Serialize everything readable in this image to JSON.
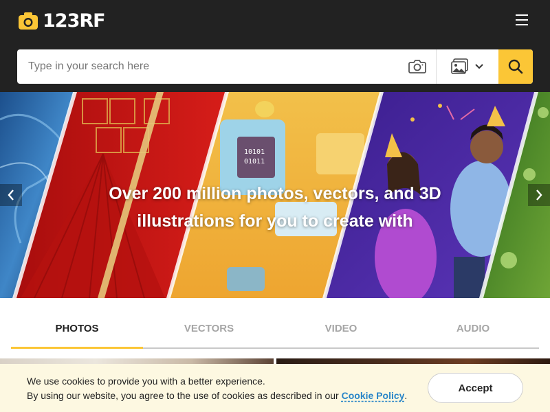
{
  "brand": {
    "logo_text": "123RF",
    "accent_color": "#fbc636",
    "header_bg": "#222222"
  },
  "header": {
    "menu_icon": "hamburger-menu-icon"
  },
  "search": {
    "placeholder": "Type in your search here",
    "value": "",
    "camera_icon": "camera-icon",
    "type_icon": "image-icon",
    "dropdown_icon": "chevron-down-icon",
    "submit_icon": "search-icon"
  },
  "hero": {
    "title_line1": "Over 200 million photos, vectors, and 3D",
    "title_line2": "illustrations for you to create with",
    "prev_icon": "chevron-left-icon",
    "next_icon": "chevron-right-icon"
  },
  "tabs": [
    {
      "label": "PHOTOS",
      "active": true
    },
    {
      "label": "VECTORS",
      "active": false
    },
    {
      "label": "VIDEO",
      "active": false
    },
    {
      "label": "AUDIO",
      "active": false
    }
  ],
  "cookie": {
    "line1": "We use cookies to provide you with a better experience.",
    "line2_prefix": "By using our website, you agree to the use of cookies as described in our",
    "link_text": "Cookie Policy",
    "line2_suffix": ".",
    "accept_label": "Accept",
    "background": "#fdf8e1"
  }
}
